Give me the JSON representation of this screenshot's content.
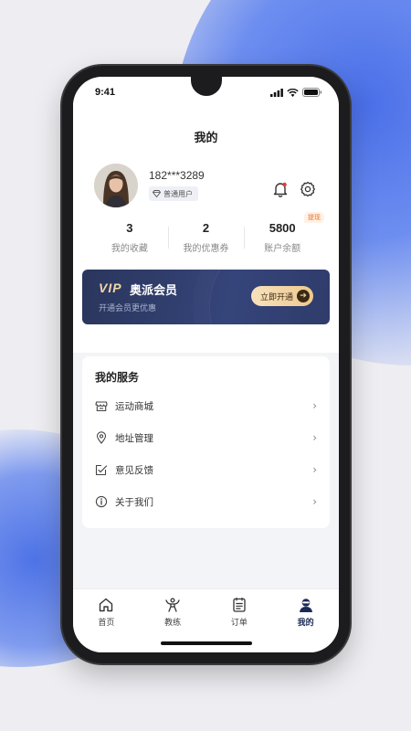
{
  "status_bar": {
    "time": "9:41"
  },
  "header": {
    "title": "我的"
  },
  "profile": {
    "phone": "182***3289",
    "badge_label": "普通用户",
    "icons": [
      "bell-icon",
      "gear-icon"
    ],
    "notification_dot_color": "#e53935"
  },
  "stats": [
    {
      "value": "3",
      "label": "我的收藏"
    },
    {
      "value": "2",
      "label": "我的优惠券"
    },
    {
      "value": "5800",
      "label": "账户余额",
      "tag": "提现"
    }
  ],
  "vip": {
    "logo": "VIP",
    "title": "奥派会员",
    "subtitle": "开通会员更优惠",
    "button_label": "立即开通",
    "colors": {
      "card": "#2a365c",
      "gold": "#f3d7a8"
    }
  },
  "services": {
    "title": "我的服务",
    "items": [
      {
        "label": "运动商城",
        "icon": "store-icon"
      },
      {
        "label": "地址管理",
        "icon": "location-pin-icon"
      },
      {
        "label": "意见反馈",
        "icon": "feedback-icon"
      },
      {
        "label": "关于我们",
        "icon": "info-icon"
      }
    ]
  },
  "tabbar": {
    "items": [
      {
        "label": "首页",
        "icon": "home-icon"
      },
      {
        "label": "教练",
        "icon": "coach-icon"
      },
      {
        "label": "订单",
        "icon": "order-icon"
      },
      {
        "label": "我的",
        "icon": "profile-icon",
        "active": true
      }
    ],
    "active_color": "#1b2a55"
  }
}
